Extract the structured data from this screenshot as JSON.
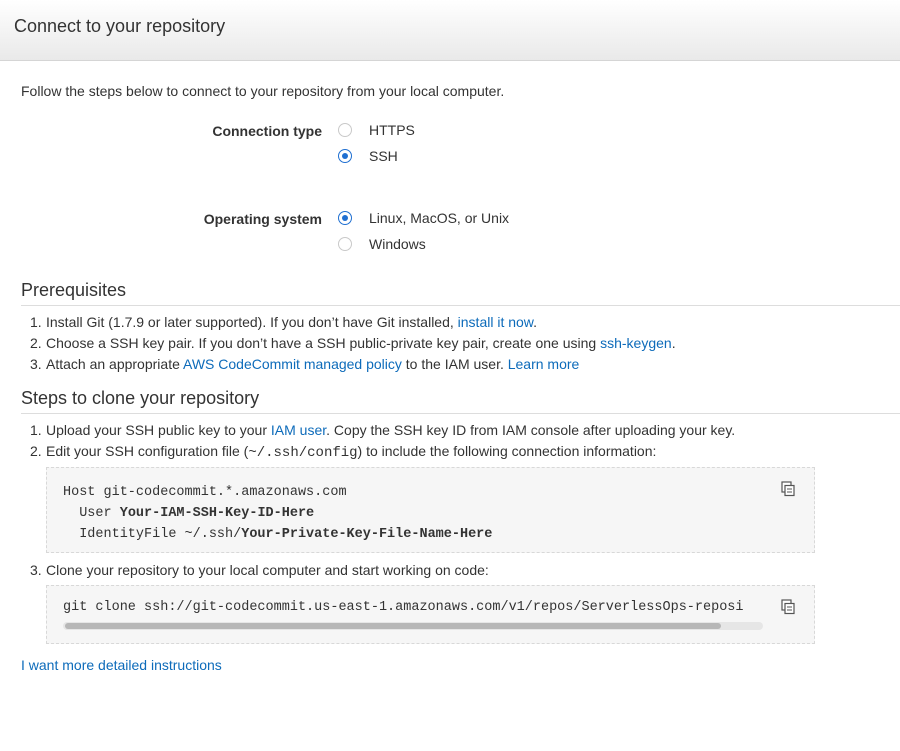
{
  "header": {
    "title": "Connect to your repository"
  },
  "intro": "Follow the steps below to connect to your repository from your local computer.",
  "connection": {
    "label": "Connection type",
    "options": [
      {
        "label": "HTTPS",
        "selected": false
      },
      {
        "label": "SSH",
        "selected": true
      }
    ]
  },
  "os": {
    "label": "Operating system",
    "options": [
      {
        "label": "Linux, MacOS, or Unix",
        "selected": true
      },
      {
        "label": "Windows",
        "selected": false
      }
    ]
  },
  "prerequisites": {
    "title": "Prerequisites",
    "items": [
      {
        "num": "1.",
        "pre": "Install Git (1.7.9 or later supported). If you don’t have Git installed, ",
        "link": "install it now",
        "post": "."
      },
      {
        "num": "2.",
        "pre": "Choose a SSH key pair. If you don’t have a SSH public-private key pair, create one using ",
        "link": "ssh-keygen",
        "post": "."
      },
      {
        "num": "3.",
        "pre": "Attach an appropriate ",
        "link": "AWS CodeCommit managed policy",
        "mid": " to the IAM user. ",
        "link2": "Learn more"
      }
    ]
  },
  "clone": {
    "title": "Steps to clone your repository",
    "step1": {
      "num": "1.",
      "pre": "Upload your SSH public key to your ",
      "link": "IAM user",
      "post": ". Copy the SSH key ID from IAM console after uploading your key."
    },
    "step2": {
      "num": "2.",
      "pre": "Edit your SSH configuration file (",
      "code": "~/.ssh/config",
      "post": ") to include the following connection information:"
    },
    "config": {
      "line1": "Host git-codecommit.*.amazonaws.com",
      "line2_pre": "  User ",
      "line2_bold": "Your-IAM-SSH-Key-ID-Here",
      "line3_pre": "  IdentityFile ~/.ssh/",
      "line3_bold": "Your-Private-Key-File-Name-Here"
    },
    "step3": {
      "num": "3.",
      "text": "Clone your repository to your local computer and start working on code:"
    },
    "command": "git clone ssh://git-codecommit.us-east-1.amazonaws.com/v1/repos/ServerlessOps-reposi"
  },
  "more_link": "I want more detailed instructions",
  "icons": {
    "copy": "copy-icon"
  },
  "colors": {
    "accent": "#1f6fd1",
    "link": "#0d6bba"
  }
}
